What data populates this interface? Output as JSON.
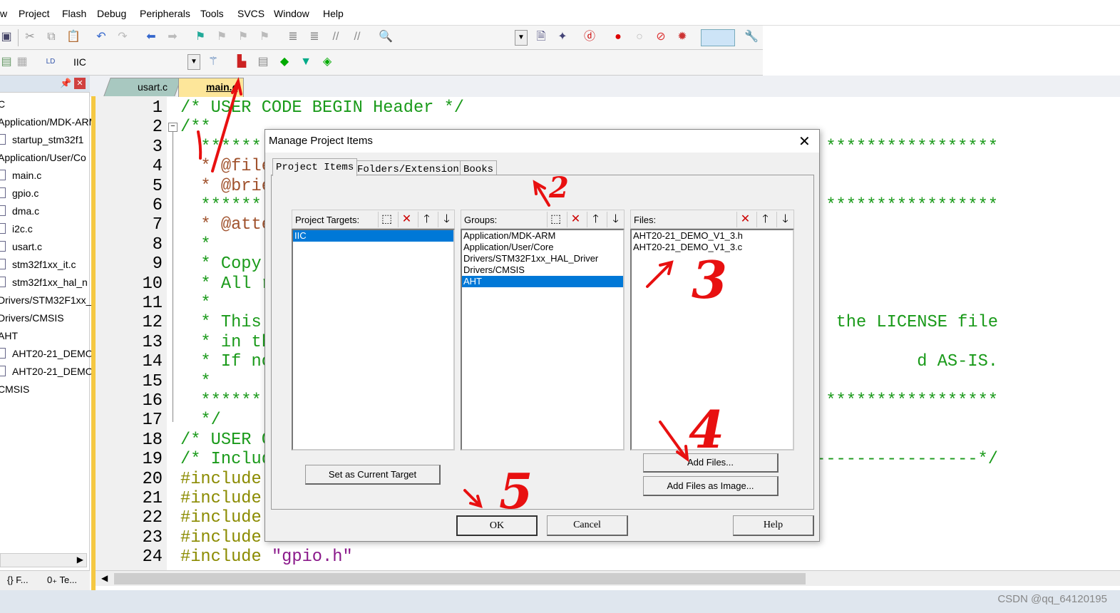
{
  "menu": [
    "w",
    "Project",
    "Flash",
    "Debug",
    "Peripherals",
    "Tools",
    "SVCS",
    "Window",
    "Help"
  ],
  "toolbar2": {
    "target": "IIC"
  },
  "editor_tabs": [
    "usart.c",
    "main.c"
  ],
  "sidebar": {
    "items": [
      "C",
      "Application/MDK-ARM",
      "startup_stm32f1",
      "Application/User/Co",
      "main.c",
      "gpio.c",
      "dma.c",
      "i2c.c",
      "usart.c",
      "stm32f1xx_it.c",
      "stm32f1xx_hal_n",
      "Drivers/STM32F1xx_",
      "Drivers/CMSIS",
      "AHT",
      "AHT20-21_DEMO",
      "AHT20-21_DEMO",
      "CMSIS"
    ],
    "bottom_tabs": [
      "{} F...",
      "0₊ Te..."
    ]
  },
  "code": {
    "left": [
      "/* USER CODE BEGIN Header */",
      "/**",
      "  ******",
      "  * @file",
      "  * @brie",
      "  ******",
      "  * @atte",
      "  *",
      "  * Copy",
      "  * All r",
      "  *",
      "  * This",
      "  * in th",
      "  * If no",
      "  *",
      "  ******",
      "  */",
      "/* USER C",
      "/* Includ",
      "#include",
      "#include",
      "#include",
      "#include",
      "#include \"gpio.h\""
    ],
    "right": {
      "3": "*****************",
      "6": "*****************",
      "12": "the LICENSE file",
      "14": "d AS-IS.",
      "16": "*****************",
      "19": "----------------*/"
    }
  },
  "dialog": {
    "title": "Manage Project Items",
    "tabs": [
      "Project Items",
      "Folders/Extensions",
      "Books"
    ],
    "targets": {
      "label": "Project Targets:",
      "items": [
        "IIC"
      ],
      "selected": "IIC"
    },
    "groups": {
      "label": "Groups:",
      "items": [
        "Application/MDK-ARM",
        "Application/User/Core",
        "Drivers/STM32F1xx_HAL_Driver",
        "Drivers/CMSIS",
        "AHT"
      ],
      "selected": "AHT"
    },
    "files": {
      "label": "Files:",
      "items": [
        "AHT20-21_DEMO_V1_3.h",
        "AHT20-21_DEMO_V1_3.c"
      ]
    },
    "buttons": {
      "set_target": "Set as Current Target",
      "add_files": "Add Files...",
      "add_image": "Add Files as Image...",
      "ok": "OK",
      "cancel": "Cancel",
      "help": "Help"
    }
  },
  "annotations": [
    "1",
    "2",
    "3",
    "4",
    "5"
  ],
  "watermark": "CSDN @qq_64120195",
  "colors": {
    "selection": "#0078d7",
    "comment": "#1a9a1a",
    "annotation": "#e81010"
  }
}
